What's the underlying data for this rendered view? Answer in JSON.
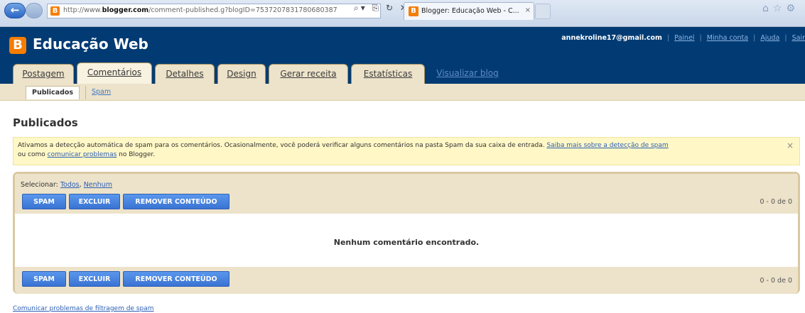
{
  "browser": {
    "address_prefix": "http://www.",
    "address_host": "blogger.com",
    "address_rest": "/comment-published.g?blogID=7537207831780680387",
    "tab_title": "Blogger: Educação Web - C...",
    "tab_close": "×"
  },
  "header": {
    "logo_letter": "B",
    "blog_title": "Educação Web",
    "user_email": "annekroline17@gmail.com",
    "links": [
      "Painel",
      "Minha conta",
      "Ajuda",
      "Sair"
    ]
  },
  "tabs": [
    {
      "label": "Postagem"
    },
    {
      "label": "Comentários"
    },
    {
      "label": "Detalhes"
    },
    {
      "label": "Design"
    },
    {
      "label": "Gerar receita"
    },
    {
      "label": "Estatísticas"
    },
    {
      "label": "Visualizar blog"
    }
  ],
  "subtabs": {
    "published": "Publicados",
    "spam": "Spam"
  },
  "main": {
    "title": "Publicados",
    "notice_text_1": "Ativamos a detecção automática de spam para os comentários. Ocasionalmente, você poderá verificar alguns comentários na pasta Spam da sua caixa de entrada. ",
    "notice_link_1": "Saiba mais sobre a detecção de spam",
    "notice_text_2": "ou como ",
    "notice_link_2": "comunicar problemas",
    "notice_text_3": " no Blogger.",
    "notice_close": "×",
    "select_label": "Selecionar: ",
    "select_all": "Todos",
    "select_none": "Nenhum",
    "btn_spam": "SPAM",
    "btn_delete": "EXCLUIR",
    "btn_remove": "REMOVER CONTEÚDO",
    "count_text": "0 - 0 de 0",
    "empty_message": "Nenhum comentário encontrado.",
    "footer_link": "Comunicar problemas de filtragem de spam"
  }
}
